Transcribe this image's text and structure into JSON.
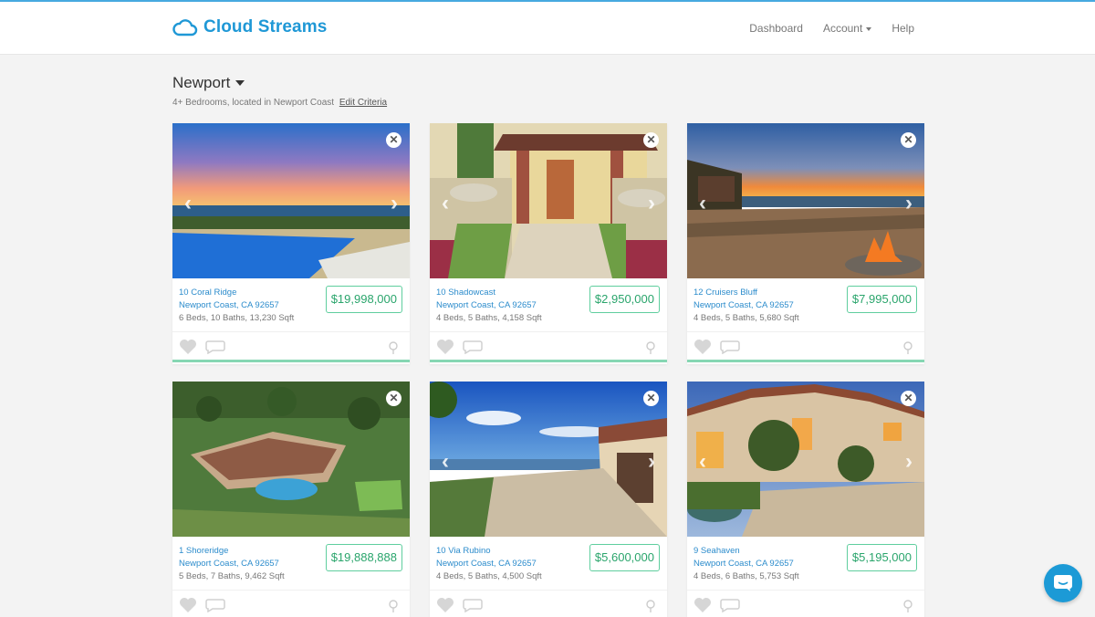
{
  "app": {
    "brand": "Cloud Streams",
    "accent": "#1f98d6",
    "price_color": "#2aa56c"
  },
  "nav": {
    "dashboard": "Dashboard",
    "account": "Account",
    "help": "Help"
  },
  "search": {
    "title": "Newport",
    "criteria": "4+ Bedrooms, located in Newport Coast",
    "edit_link": "Edit Criteria"
  },
  "listings": [
    {
      "address": "10 Coral Ridge",
      "city": "Newport Coast, CA 92657",
      "details": "6 Beds, 10 Baths, 13,230 Sqft",
      "price": "$19,998,000",
      "photo": "pool-sunset"
    },
    {
      "address": "10 Shadowcast",
      "city": "Newport Coast, CA 92657",
      "details": "4 Beds, 5 Baths, 4,158 Sqft",
      "price": "$2,950,000",
      "photo": "front-entry"
    },
    {
      "address": "12 Cruisers Bluff",
      "city": "Newport Coast, CA 92657",
      "details": "4 Beds, 5 Baths, 5,680 Sqft",
      "price": "$7,995,000",
      "photo": "patio-firepit"
    },
    {
      "address": "1 Shoreridge",
      "city": "Newport Coast, CA 92657",
      "details": "5 Beds, 7 Baths, 9,462 Sqft",
      "price": "$19,888,888",
      "photo": "aerial-estate"
    },
    {
      "address": "10 Via Rubino",
      "city": "Newport Coast, CA 92657",
      "details": "4 Beds, 5 Baths, 4,500 Sqft",
      "price": "$5,600,000",
      "photo": "ocean-terrace"
    },
    {
      "address": "9 Seahaven",
      "city": "Newport Coast, CA 92657",
      "details": "4 Beds, 6 Baths, 5,753 Sqft",
      "price": "$5,195,000",
      "photo": "villa-dusk"
    }
  ],
  "icons": {
    "logo": "cloud-icon",
    "close": "close-icon",
    "favorite": "heart-icon",
    "comment": "comment-icon",
    "map": "map-pin-icon",
    "chat": "chat-icon"
  }
}
